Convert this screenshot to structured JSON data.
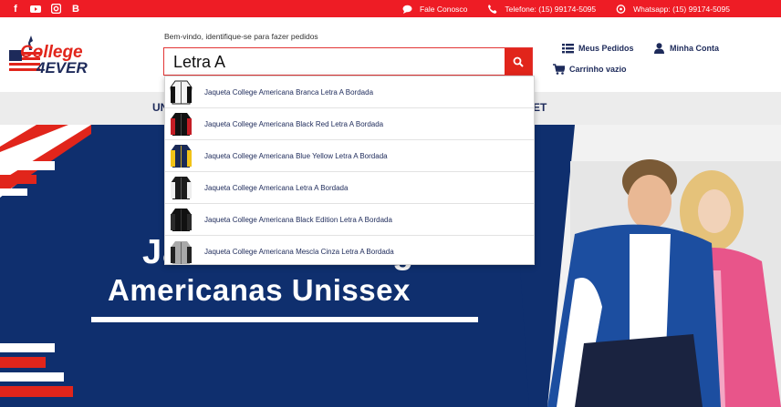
{
  "topbar": {
    "social": [
      {
        "icon": "facebook-icon",
        "glyph": "f"
      },
      {
        "icon": "youtube-icon",
        "glyph": "▶"
      },
      {
        "icon": "instagram-icon",
        "glyph": "◎"
      },
      {
        "icon": "blog-icon",
        "glyph": "B"
      }
    ],
    "contacts": [
      {
        "icon": "chat-icon",
        "label": "Fale Conosco"
      },
      {
        "icon": "phone-icon",
        "label": "Telefone: (15) 99174-5095"
      },
      {
        "icon": "whatsapp-icon",
        "label": "Whatsapp: (15) 99174-5095"
      }
    ]
  },
  "header": {
    "logo_top": "College",
    "logo_bottom": "4EVER",
    "welcome": "Bem-vindo, identifique-se para fazer pedidos",
    "search_value": "Letra A",
    "links": {
      "orders": "Meus Pedidos",
      "account": "Minha Conta",
      "cart": "Carrinho vazio"
    }
  },
  "nav": {
    "left_partial": "UN",
    "right_partial": "ET"
  },
  "hero": {
    "title_line1": "Ja",
    "title_line1_right": "g",
    "title_line2": "Americanas Unissex"
  },
  "suggestions": [
    {
      "label": "Jaqueta College Americana Branca Letra A Bordada"
    },
    {
      "label": "Jaqueta College Americana Black Red Letra A Bordada"
    },
    {
      "label": "Jaqueta College Americana Blue Yellow Letra A Bordada"
    },
    {
      "label": "Jaqueta College Americana Letra A Bordada"
    },
    {
      "label": "Jaqueta College Americana Black Edition Letra A Bordada"
    },
    {
      "label": "Jaqueta College Americana Mescla Cinza Letra A Bordada"
    }
  ],
  "colors": {
    "brand_red": "#ee1c25",
    "navy": "#1d2a5a",
    "hero_blue": "#0f2f6e"
  }
}
